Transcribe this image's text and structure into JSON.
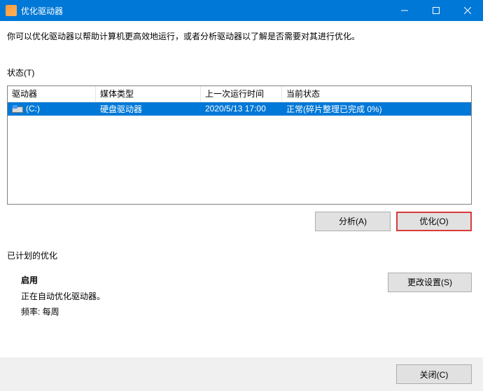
{
  "window": {
    "title": "优化驱动器"
  },
  "description": "你可以优化驱动器以帮助计算机更高效地运行，或者分析驱动器以了解是否需要对其进行优化。",
  "status_label": "状态(T)",
  "columns": {
    "drive": "驱动器",
    "media": "媒体类型",
    "lastrun": "上一次运行时间",
    "state": "当前状态"
  },
  "rows": [
    {
      "drive": "(C:)",
      "media": "硬盘驱动器",
      "lastrun": "2020/5/13 17:00",
      "state": "正常(碎片整理已完成 0%)"
    }
  ],
  "buttons": {
    "analyze": "分析(A)",
    "optimize": "优化(O)",
    "change": "更改设置(S)",
    "close": "关闭(C)"
  },
  "scheduled": {
    "section": "已计划的优化",
    "title": "启用",
    "line1": "正在自动优化驱动器。",
    "line2": "频率: 每周"
  }
}
